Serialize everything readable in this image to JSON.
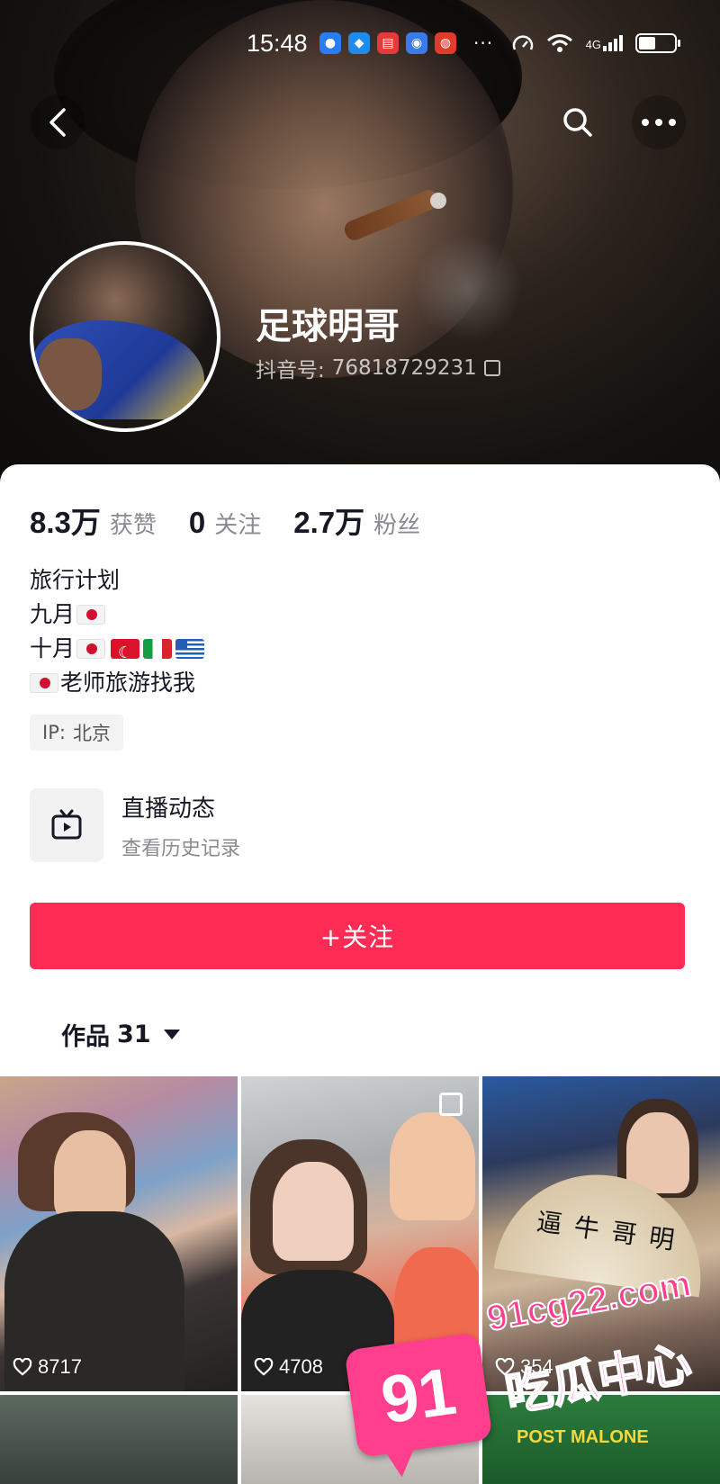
{
  "status_bar": {
    "time": "15:48",
    "network": "4G",
    "more_indicator": "···"
  },
  "profile": {
    "username": "足球明哥",
    "douyin_id_label": "抖音号:",
    "douyin_id": "76818729231"
  },
  "stats": {
    "likes_value": "8.3万",
    "likes_label": "获赞",
    "following_value": "0",
    "following_label": "关注",
    "followers_value": "2.7万",
    "followers_label": "粉丝"
  },
  "bio": {
    "line1": "旅行计划",
    "line2_text": "九月",
    "line3_text": "十月",
    "line4_text": "老师旅游找我",
    "line2_flags": [
      "jp"
    ],
    "line3_flags": [
      "jp",
      "tr",
      "it",
      "gr"
    ],
    "line4_flags": [
      "jp"
    ]
  },
  "ip": {
    "label": "IP:",
    "value": "北京"
  },
  "live": {
    "title": "直播动态",
    "subtitle": "查看历史记录"
  },
  "follow_button": {
    "label": "+关注"
  },
  "works": {
    "label": "作品",
    "count": "31"
  },
  "videos": [
    {
      "likes": "8717"
    },
    {
      "likes": "4708"
    },
    {
      "likes": "354"
    },
    {
      "likes": ""
    },
    {
      "likes": ""
    },
    {
      "likes": ""
    }
  ],
  "video_text": {
    "fan_text": "逼牛哥明",
    "banner_text": "POST MALONE"
  },
  "watermark": {
    "badge": "91",
    "url": "91cg22.com",
    "title": "吃瓜中心"
  },
  "colors": {
    "accent": "#fe2c55",
    "text_primary": "#161823",
    "text_secondary": "#8a8b91",
    "watermark_pink": "#ff3f8e"
  }
}
